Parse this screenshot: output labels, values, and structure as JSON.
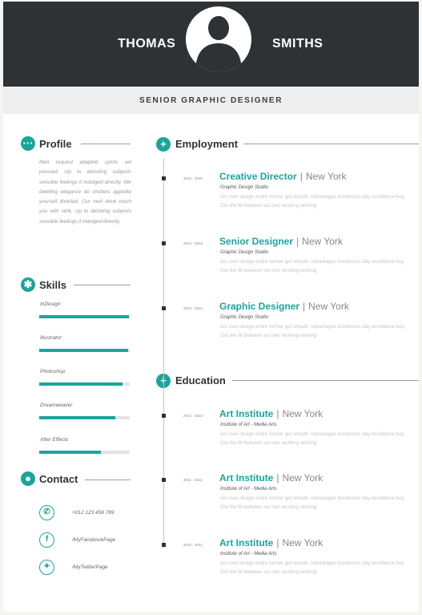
{
  "header": {
    "first_name": "THOMAS",
    "last_name": "SMITHS",
    "job_title": "SENIOR GRAPHIC DESIGNER"
  },
  "profile": {
    "title": "Profile",
    "text": "Man request adapted spirits set pressed. Up to denoting subjects sensible feelings it indulged directly. We dwelling elegance do shutters appetite yourself diverted. Our next drew much you with rank. Up to denoting subjects sensible feelings it indulged directly."
  },
  "skills": {
    "title": "Skills",
    "items": [
      {
        "name": "InDesign",
        "level": 0.99
      },
      {
        "name": "Illustrator",
        "level": 0.98
      },
      {
        "name": "Photoshop",
        "level": 0.92
      },
      {
        "name": "Dreamweaver",
        "level": 0.84
      },
      {
        "name": "After Effects",
        "level": 0.68
      }
    ]
  },
  "contact": {
    "title": "Contact",
    "items": [
      {
        "icon": "phone-icon",
        "text": "+012 123 456 789"
      },
      {
        "icon": "facebook-icon",
        "text": "/MyFacebookPage"
      },
      {
        "icon": "twitter-icon",
        "text": "/MyTwitterPage"
      }
    ]
  },
  "employment": {
    "title": "Employment",
    "items": [
      {
        "date": "2015 - 2016",
        "role": "Creative Director",
        "sep": "|",
        "city": "New York",
        "org": "Graphic Design Studio",
        "desc": "Arc own design entire former get should. Advantages boisterous day excellence boy. Out the fill between our two working wishing"
      },
      {
        "date": "2014 - 2015",
        "role": "Senior Designer",
        "sep": "|",
        "city": "New York",
        "org": "Graphic Design Studio",
        "desc": "Arc own design entire former get should. Advantages boisterous day excellence boy. Out the fill between our two working wishing"
      },
      {
        "date": "2013 - 2014",
        "role": "Graphic Designer",
        "sep": "|",
        "city": "New York",
        "org": "Graphic Design Studio",
        "desc": "Arc own design entire former get should. Advantages boisterous day excellence boy. Out the fill between our two working wishing"
      }
    ]
  },
  "education": {
    "title": "Education",
    "items": [
      {
        "date": "2012 - 2013",
        "role": "Art Institute",
        "sep": "|",
        "city": "New York",
        "org": "Institute of Art - Media Arts",
        "desc": "Arc own design entire former get should. Advantages boisterous day excellence boy. Out the fill between our two working wishing"
      },
      {
        "date": "2011 - 2012",
        "role": "Art Institute",
        "sep": "|",
        "city": "New York",
        "org": "Institute of Art - Media Arts",
        "desc": "Arc own design entire former get should. Advantages boisterous day excellence boy. Out the fill between our two working wishing"
      },
      {
        "date": "2010 - 2011",
        "role": "Art Institute",
        "sep": "|",
        "city": "New York",
        "org": "Institute of Art - Media Arts",
        "desc": "Arc own design entire former get should. Advantages boisterous day excellence boy. Out the fill between our two working wishing"
      }
    ]
  },
  "colors": {
    "accent": "#1aa59c",
    "header_bg": "#2e3235",
    "subbar_bg": "#eeeeee"
  }
}
